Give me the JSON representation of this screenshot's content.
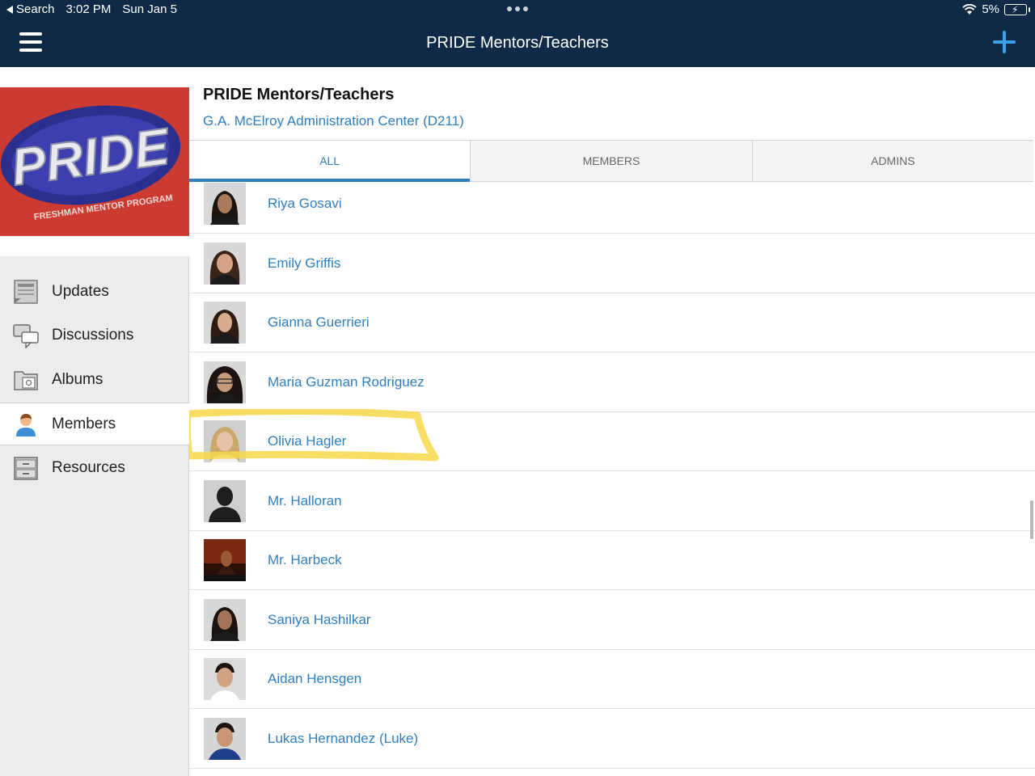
{
  "status_bar": {
    "back_label": "Search",
    "time": "3:02 PM",
    "date": "Sun Jan 5",
    "battery": "5%"
  },
  "nav": {
    "title": "PRIDE Mentors/Teachers",
    "menu_icon": "hamburger-menu-icon",
    "add_icon": "plus-icon"
  },
  "logo": {
    "text": "PRIDE",
    "tagline": "FRESHMAN MENTOR PROGRAM",
    "colors": {
      "background": "#cc3b32",
      "oval": "#2a2f8e"
    }
  },
  "sidebar": {
    "items": [
      {
        "label": "Updates",
        "icon": "updates-icon",
        "active": false
      },
      {
        "label": "Discussions",
        "icon": "discussions-icon",
        "active": false
      },
      {
        "label": "Albums",
        "icon": "albums-icon",
        "active": false
      },
      {
        "label": "Members",
        "icon": "members-icon",
        "active": true
      },
      {
        "label": "Resources",
        "icon": "resources-icon",
        "active": false
      }
    ]
  },
  "group": {
    "title": "PRIDE Mentors/Teachers",
    "location": "G.A. McElroy Administration Center (D211)"
  },
  "tabs": [
    {
      "label": "ALL",
      "active": true
    },
    {
      "label": "MEMBERS",
      "active": false
    },
    {
      "label": "ADMINS",
      "active": false
    }
  ],
  "members": [
    {
      "name": "Riya Gosavi",
      "avatar": "photo"
    },
    {
      "name": "Emily Griffis",
      "avatar": "photo"
    },
    {
      "name": "Gianna Guerrieri",
      "avatar": "photo"
    },
    {
      "name": "Maria Guzman Rodriguez",
      "avatar": "photo"
    },
    {
      "name": "Olivia Hagler",
      "avatar": "photo",
      "highlighted": true
    },
    {
      "name": "Mr. Halloran",
      "avatar": "default-silhouette"
    },
    {
      "name": "Mr. Harbeck",
      "avatar": "photo-dark"
    },
    {
      "name": "Saniya Hashilkar",
      "avatar": "photo"
    },
    {
      "name": "Aidan Hensgen",
      "avatar": "photo"
    },
    {
      "name": "Lukas Hernandez (Luke)",
      "avatar": "photo-blue"
    }
  ],
  "colors": {
    "nav_background": "#0f2a47",
    "accent": "#2f7fc0",
    "add_button": "#3aa0e8",
    "highlight": "#f7d84a"
  }
}
